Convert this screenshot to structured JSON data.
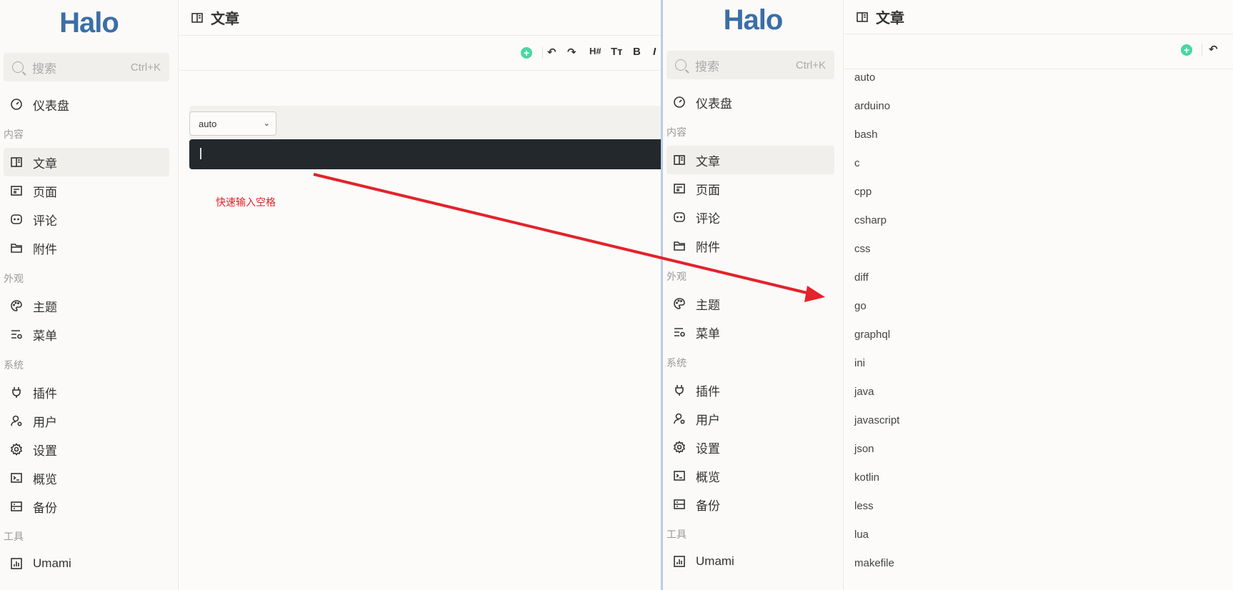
{
  "sidebar": {
    "logo": "Halo",
    "search_placeholder": "搜索",
    "search_shortcut": "Ctrl+K",
    "dashboard": "仪表盘",
    "sections": {
      "content": "内容",
      "appearance": "外观",
      "system": "系统",
      "tools": "工具"
    },
    "items": {
      "posts": "文章",
      "pages": "页面",
      "comments": "评论",
      "attachments": "附件",
      "themes": "主题",
      "menus": "菜单",
      "plugins": "插件",
      "users": "用户",
      "settings": "设置",
      "overview": "概览",
      "backup": "备份",
      "umami": "Umami"
    }
  },
  "page_title": "文章",
  "toolbar": {
    "heading": "H#",
    "text_size": "Tт",
    "bold": "B",
    "italic": "I"
  },
  "editor": {
    "selected_language": "auto",
    "annotation": "快速输入空格"
  },
  "language_options": [
    "auto",
    "arduino",
    "bash",
    "c",
    "cpp",
    "csharp",
    "css",
    "diff",
    "go",
    "graphql",
    "ini",
    "java",
    "javascript",
    "json",
    "kotlin",
    "less",
    "lua",
    "makefile"
  ],
  "colors": {
    "accent": "#4ad6a0",
    "logo": "#3b6ea8",
    "arrow": "#e3222b",
    "code_bg": "#23282c"
  }
}
